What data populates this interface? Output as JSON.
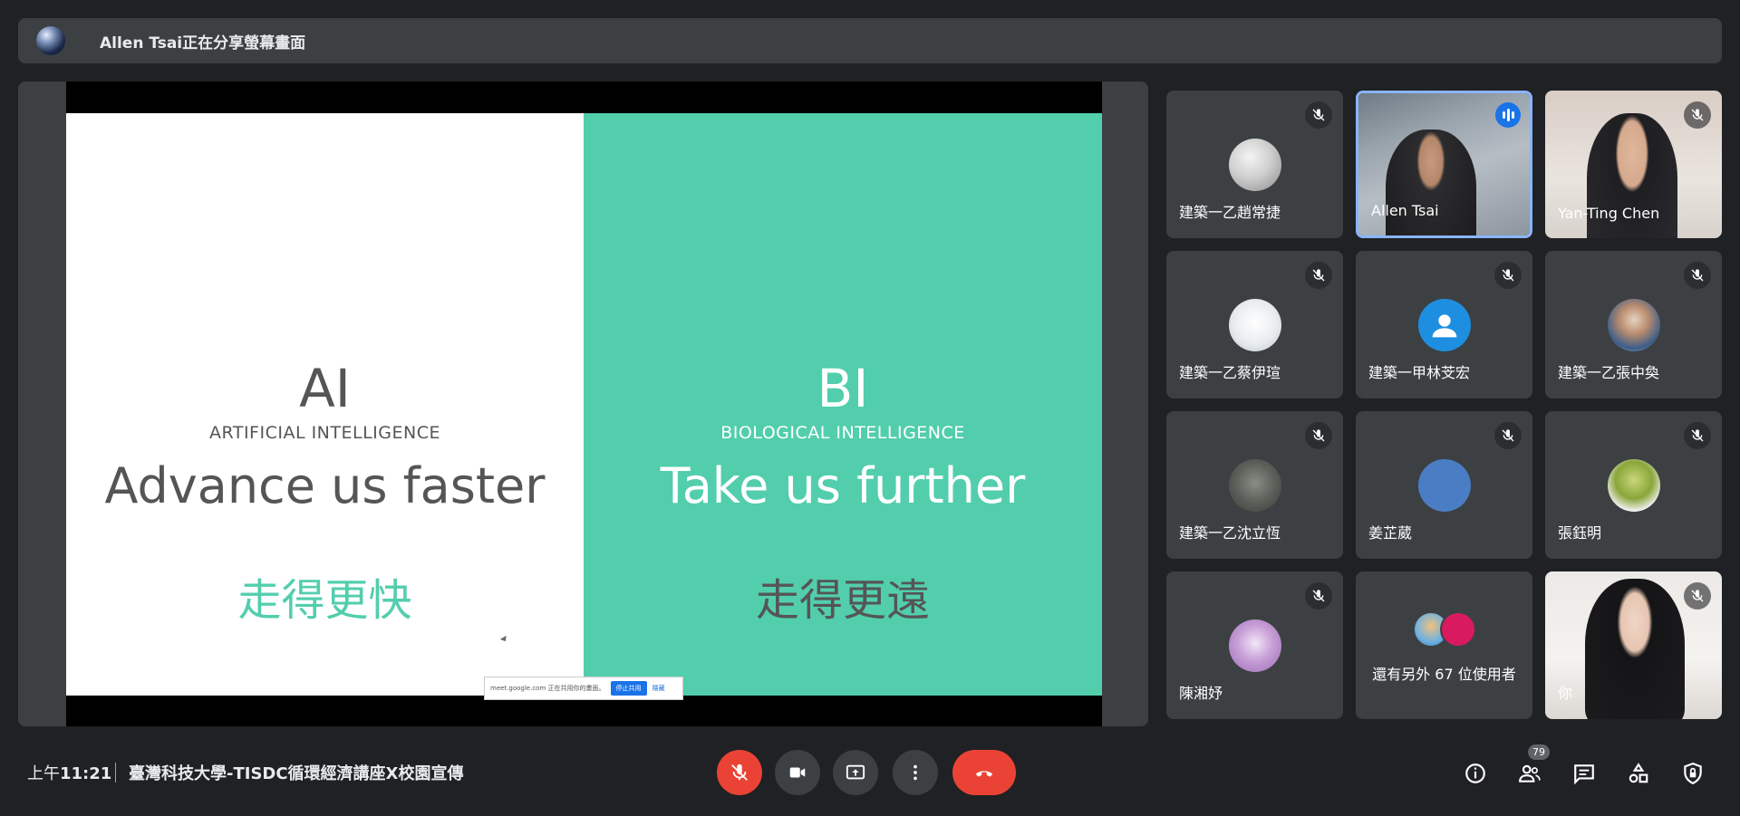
{
  "banner": {
    "text": "Allen Tsai正在分享螢幕畫面"
  },
  "slide": {
    "left": {
      "title": "AI",
      "subtitle": "ARTIFICIAL INTELLIGENCE",
      "tagline": "Advance us faster",
      "chinese": "走得更快"
    },
    "right": {
      "title": "BI",
      "subtitle": "BIOLOGICAL INTELLIGENCE",
      "tagline": "Take us further",
      "chinese": "走得更遠"
    },
    "share_bar": {
      "text": "meet.google.com 正在共用你的畫面。",
      "stop_label": "停止共用",
      "hide_label": "隱藏"
    }
  },
  "participants": [
    {
      "name": "建築一乙趙常捷",
      "muted": true
    },
    {
      "name": "Allen Tsai",
      "speaking": true
    },
    {
      "name": "Yan-Ting Chen",
      "muted": true
    },
    {
      "name": "建築一乙蔡伊瑄",
      "muted": true
    },
    {
      "name": "建築一甲林芠宏",
      "muted": true
    },
    {
      "name": "建築一乙張中奐",
      "muted": true
    },
    {
      "name": "建築一乙沈立恆",
      "muted": true
    },
    {
      "name": "姜芷葳",
      "muted": true
    },
    {
      "name": "張鈺明",
      "muted": true
    },
    {
      "name": "陳湘妤",
      "muted": true
    },
    {
      "name": "還有另外 67 位使用者"
    },
    {
      "name": "你",
      "muted": true
    }
  ],
  "footer": {
    "time_prefix": "上午",
    "time": "11:21",
    "meeting_title": "臺灣科技大學-TISDC循環經濟講座X校園宣傳",
    "people_count": "79"
  },
  "colors": {
    "accent_green": "#52cead",
    "end_red": "#ea4335",
    "speaking_blue": "#8ab4f8"
  }
}
